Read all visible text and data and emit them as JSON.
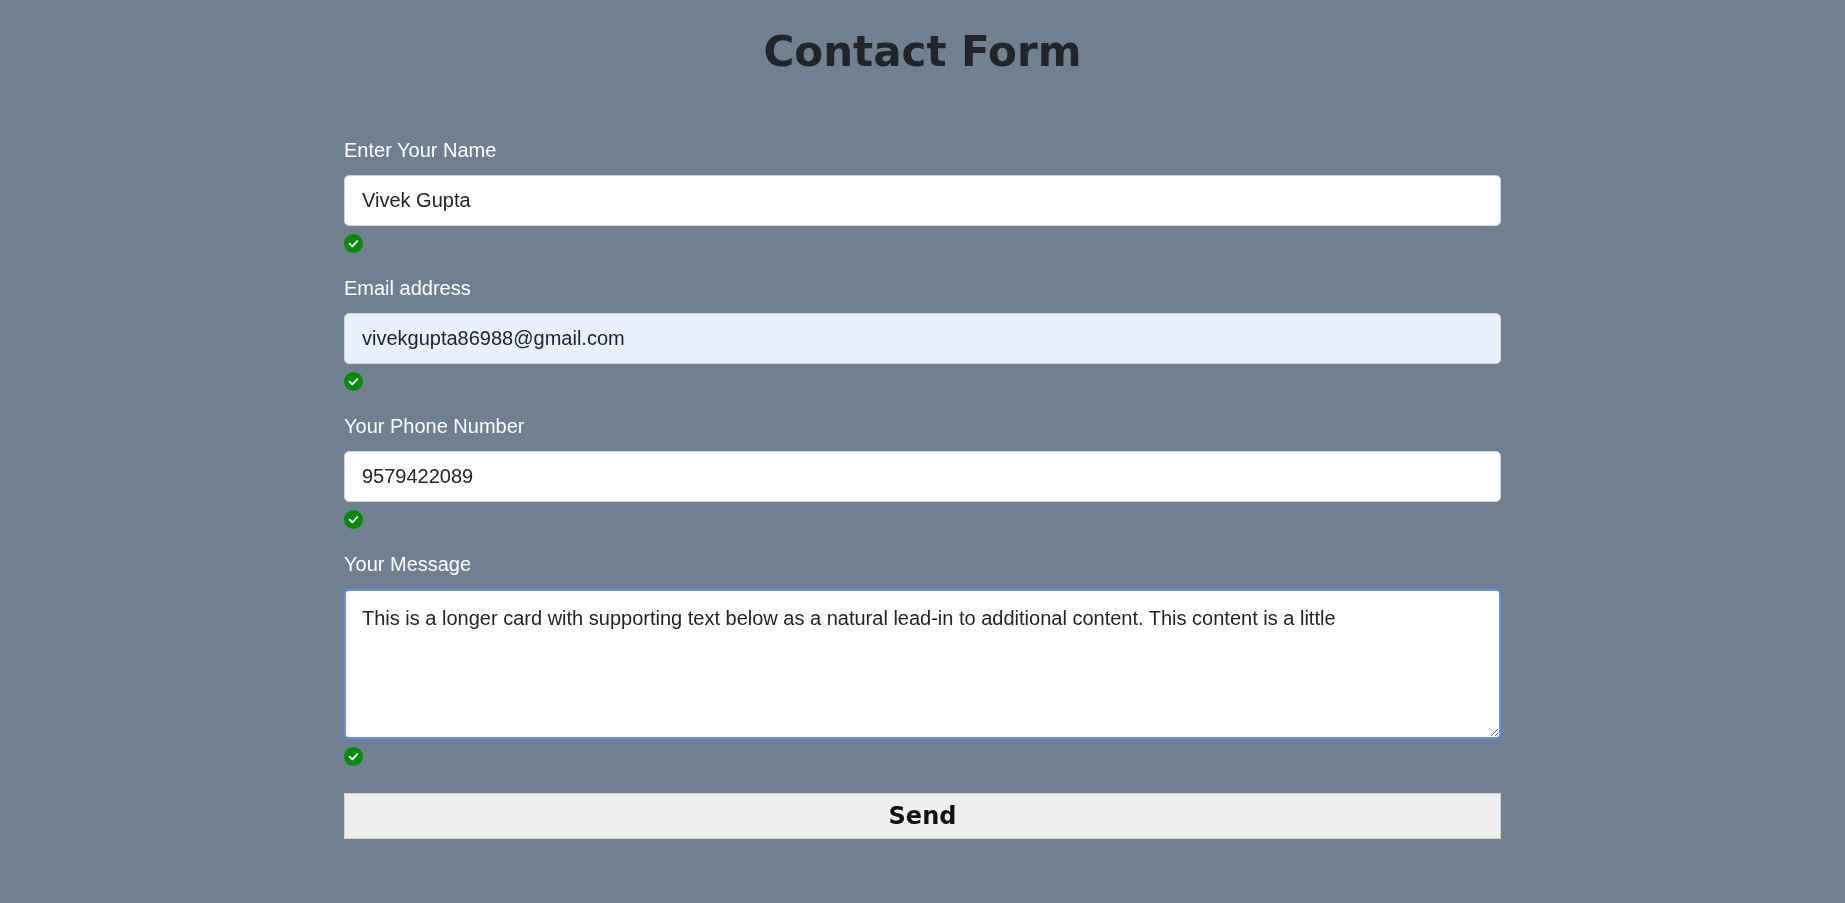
{
  "title": "Contact Form",
  "fields": [
    {
      "kind": "input",
      "label": "Enter Your Name",
      "value": "Vivek Gupta",
      "valid": true,
      "autofilled": false,
      "focused": false
    },
    {
      "kind": "input",
      "label": "Email address",
      "value": "vivekgupta86988@gmail.com",
      "valid": true,
      "autofilled": true,
      "focused": false
    },
    {
      "kind": "input",
      "label": "Your Phone Number",
      "value": "9579422089",
      "valid": true,
      "autofilled": false,
      "focused": false
    },
    {
      "kind": "textarea",
      "label": "Your Message",
      "value": "This is a longer card with supporting text below as a natural lead-in to additional content. This content is a little",
      "valid": true,
      "autofilled": false,
      "focused": true
    }
  ],
  "button": "Send"
}
